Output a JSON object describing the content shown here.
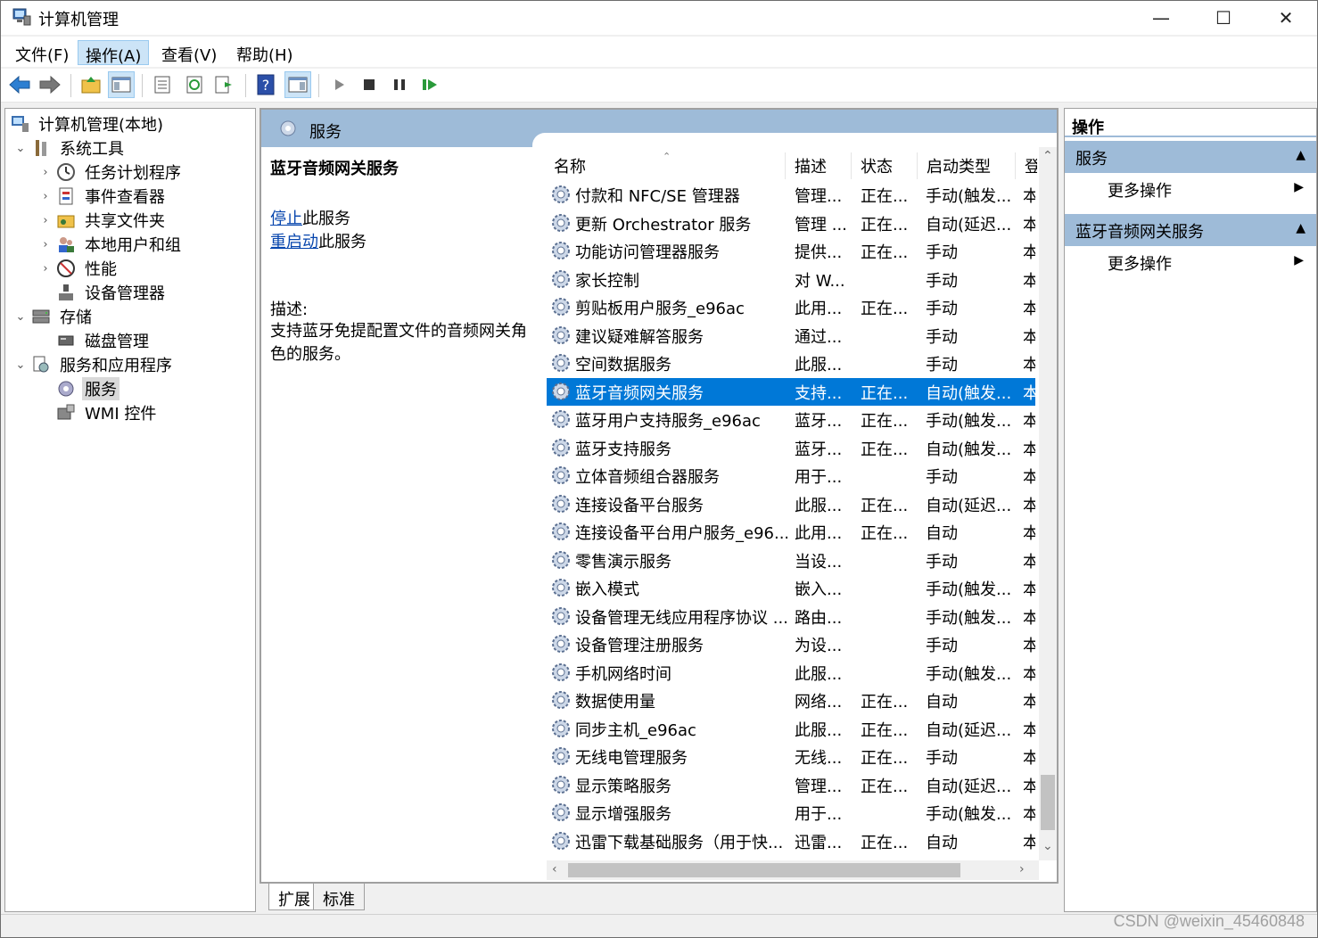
{
  "window": {
    "title": "计算机管理",
    "minimize": "—",
    "maximize": "☐",
    "close": "✕"
  },
  "menu": {
    "file": "文件(F)",
    "action": "操作(A)",
    "view": "查看(V)",
    "help": "帮助(H)"
  },
  "tree": {
    "root": "计算机管理(本地)",
    "system_tools": "系统工具",
    "task_scheduler": "任务计划程序",
    "event_viewer": "事件查看器",
    "shared_folders": "共享文件夹",
    "local_users": "本地用户和组",
    "performance": "性能",
    "device_manager": "设备管理器",
    "storage": "存储",
    "disk_management": "磁盘管理",
    "services_apps": "服务和应用程序",
    "services": "服务",
    "wmi": "WMI 控件"
  },
  "middle": {
    "header_title": "服务",
    "selected_service": "蓝牙音频网关服务",
    "stop_link": "停止",
    "stop_suffix": "此服务",
    "restart_link": "重启动",
    "restart_suffix": "此服务",
    "desc_label": "描述:",
    "desc_text": "支持蓝牙免提配置文件的音频网关角色的服务。"
  },
  "table": {
    "headers": {
      "name": "名称",
      "desc": "描述",
      "status": "状态",
      "startup": "启动类型",
      "logon": "登"
    },
    "rows": [
      {
        "name": "付款和 NFC/SE 管理器",
        "desc": "管理...",
        "status": "正在...",
        "startup": "手动(触发...",
        "logon": "本"
      },
      {
        "name": "更新 Orchestrator 服务",
        "desc": "管理 ...",
        "status": "正在...",
        "startup": "自动(延迟...",
        "logon": "本"
      },
      {
        "name": "功能访问管理器服务",
        "desc": "提供...",
        "status": "正在...",
        "startup": "手动",
        "logon": "本"
      },
      {
        "name": "家长控制",
        "desc": "对 W...",
        "status": "",
        "startup": "手动",
        "logon": "本"
      },
      {
        "name": "剪贴板用户服务_e96ac",
        "desc": "此用...",
        "status": "正在...",
        "startup": "手动",
        "logon": "本"
      },
      {
        "name": "建议疑难解答服务",
        "desc": "通过...",
        "status": "",
        "startup": "手动",
        "logon": "本"
      },
      {
        "name": "空间数据服务",
        "desc": "此服...",
        "status": "",
        "startup": "手动",
        "logon": "本"
      },
      {
        "name": "蓝牙音频网关服务",
        "desc": "支持...",
        "status": "正在...",
        "startup": "自动(触发...",
        "logon": "本"
      },
      {
        "name": "蓝牙用户支持服务_e96ac",
        "desc": "蓝牙...",
        "status": "正在...",
        "startup": "手动(触发...",
        "logon": "本"
      },
      {
        "name": "蓝牙支持服务",
        "desc": "蓝牙...",
        "status": "正在...",
        "startup": "自动(触发...",
        "logon": "本"
      },
      {
        "name": "立体音频组合器服务",
        "desc": "用于...",
        "status": "",
        "startup": "手动",
        "logon": "本"
      },
      {
        "name": "连接设备平台服务",
        "desc": "此服...",
        "status": "正在...",
        "startup": "自动(延迟...",
        "logon": "本"
      },
      {
        "name": "连接设备平台用户服务_e96...",
        "desc": "此用...",
        "status": "正在...",
        "startup": "自动",
        "logon": "本"
      },
      {
        "name": "零售演示服务",
        "desc": "当设...",
        "status": "",
        "startup": "手动",
        "logon": "本"
      },
      {
        "name": "嵌入模式",
        "desc": "嵌入...",
        "status": "",
        "startup": "手动(触发...",
        "logon": "本"
      },
      {
        "name": "设备管理无线应用程序协议 ...",
        "desc": "路由...",
        "status": "",
        "startup": "手动(触发...",
        "logon": "本"
      },
      {
        "name": "设备管理注册服务",
        "desc": "为设...",
        "status": "",
        "startup": "手动",
        "logon": "本"
      },
      {
        "name": "手机网络时间",
        "desc": "此服...",
        "status": "",
        "startup": "手动(触发...",
        "logon": "本"
      },
      {
        "name": "数据使用量",
        "desc": "网络...",
        "status": "正在...",
        "startup": "自动",
        "logon": "本"
      },
      {
        "name": "同步主机_e96ac",
        "desc": "此服...",
        "status": "正在...",
        "startup": "自动(延迟...",
        "logon": "本"
      },
      {
        "name": "无线电管理服务",
        "desc": "无线...",
        "status": "正在...",
        "startup": "手动",
        "logon": "本"
      },
      {
        "name": "显示策略服务",
        "desc": "管理...",
        "status": "正在...",
        "startup": "自动(延迟...",
        "logon": "本"
      },
      {
        "name": "显示增强服务",
        "desc": "用于...",
        "status": "",
        "startup": "手动(触发...",
        "logon": "本"
      },
      {
        "name": "迅雷下载基础服务（用于快...",
        "desc": "迅雷...",
        "status": "正在...",
        "startup": "自动",
        "logon": "本"
      }
    ],
    "selected_index": 7
  },
  "tabs": {
    "extended": "扩展",
    "standard": "标准"
  },
  "actions": {
    "header": "操作",
    "group1": "服务",
    "group1_more": "更多操作",
    "group2": "蓝牙音频网关服务",
    "group2_more": "更多操作"
  },
  "watermark": "CSDN @weixin_45460848",
  "colors": {
    "selection": "#0078d7",
    "header_band": "#9ebbd8",
    "link": "#0645ad"
  }
}
